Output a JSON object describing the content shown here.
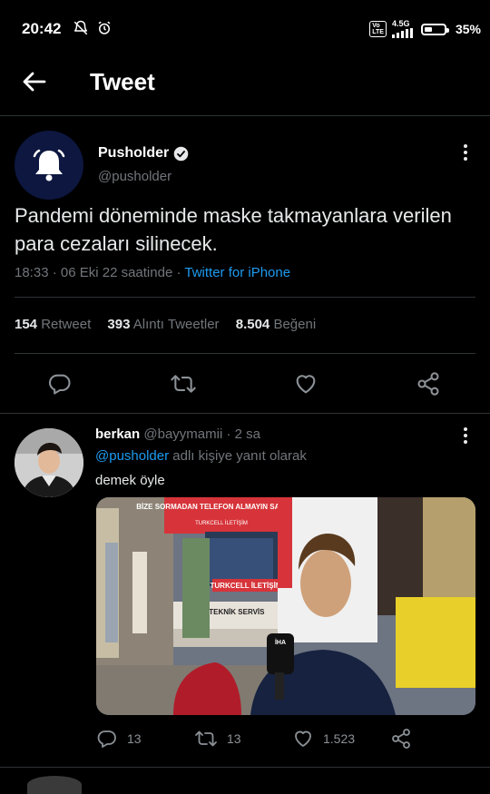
{
  "status_bar": {
    "time": "20:42",
    "network": "4.5G",
    "battery": "35%"
  },
  "header": {
    "title": "Tweet"
  },
  "tweet": {
    "author_name": "Pusholder",
    "author_handle": "@pusholder",
    "text": "Pandemi döneminde maske takmayanlara verilen para cezaları silinecek.",
    "timestamp": "18:33 · 06 Eki 22 saatinde · ",
    "source": "Twitter for iPhone",
    "retweets": "154",
    "retweets_label": "Retweet",
    "quotes": "393",
    "quotes_label": "Alıntı Tweetler",
    "likes": "8.504",
    "likes_label": "Beğeni"
  },
  "reply": {
    "author_name": "berkan",
    "author_handle": "@bayymamii",
    "time": "· 2 sa",
    "mention": "@pusholder",
    "reply_to_suffix": " adlı kişiye yanıt olarak",
    "text": "demek öyle",
    "image_signs": {
      "top": "BİZE SORMADAN TELEFON ALMAYIN SATMAYIN",
      "top_sub": "TURKCELL İLETİŞİM",
      "middle": "TURKCELL İLETİŞİM",
      "bottom": "GÜ   ILI TEKNİK SERVİS",
      "mic": "İHA"
    },
    "replies": "13",
    "retweets": "13",
    "likes": "1.523"
  },
  "colors": {
    "accent": "#1d9bf0",
    "background": "#000000",
    "muted": "#71767b",
    "divider": "#2f3336"
  }
}
